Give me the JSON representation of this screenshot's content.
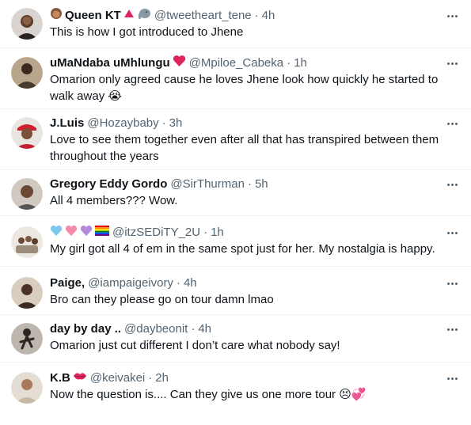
{
  "tweets": [
    {
      "name": "Queen KT",
      "handle": "@tweetheart_tene",
      "time": "4h",
      "text": "This is how I got introduced to Jhene",
      "avatar": "avatar-woman-icon"
    },
    {
      "name": "uMaNdaba uMhlungu",
      "handle": "@Mpiloe_Cabeka",
      "time": "1h",
      "text": "Omarion only agreed cause he loves Jhene look how quickly he started to walk away 😭",
      "avatar": "avatar-man-icon"
    },
    {
      "name": "J.Luis",
      "handle": "@Hozaybaby",
      "time": "3h",
      "text": "Love to see them together even after all that has transpired between them throughout the years",
      "avatar": "avatar-red-cap-icon"
    },
    {
      "name": "Gregory Eddy Gordo",
      "handle": "@SirThurman",
      "time": "5h",
      "text": "All 4 members??? Wow.",
      "avatar": "avatar-man-smiling-icon"
    },
    {
      "name": "",
      "handle": "@itzSEDiTY_2U",
      "time": "1h",
      "text": "My girl got all 4 of em in the same spot just for her. My nostalgia is happy.",
      "avatar": "avatar-group-icon"
    },
    {
      "name": "Paige,",
      "handle": "@iampaigeivory",
      "time": "4h",
      "text": "Bro can they please go on tour damn lmao",
      "avatar": "avatar-woman-dark-icon"
    },
    {
      "name": "day by day ..",
      "handle": "@daybeonit",
      "time": "4h",
      "text": "Omarion just cut different I don’t care what nobody say!",
      "avatar": "avatar-dancer-icon"
    },
    {
      "name": "K.B",
      "handle": "@keivakei",
      "time": "2h",
      "text": "Now the question is.... Can they give us one more tour 😣💞",
      "avatar": "avatar-woman-light-icon"
    }
  ]
}
